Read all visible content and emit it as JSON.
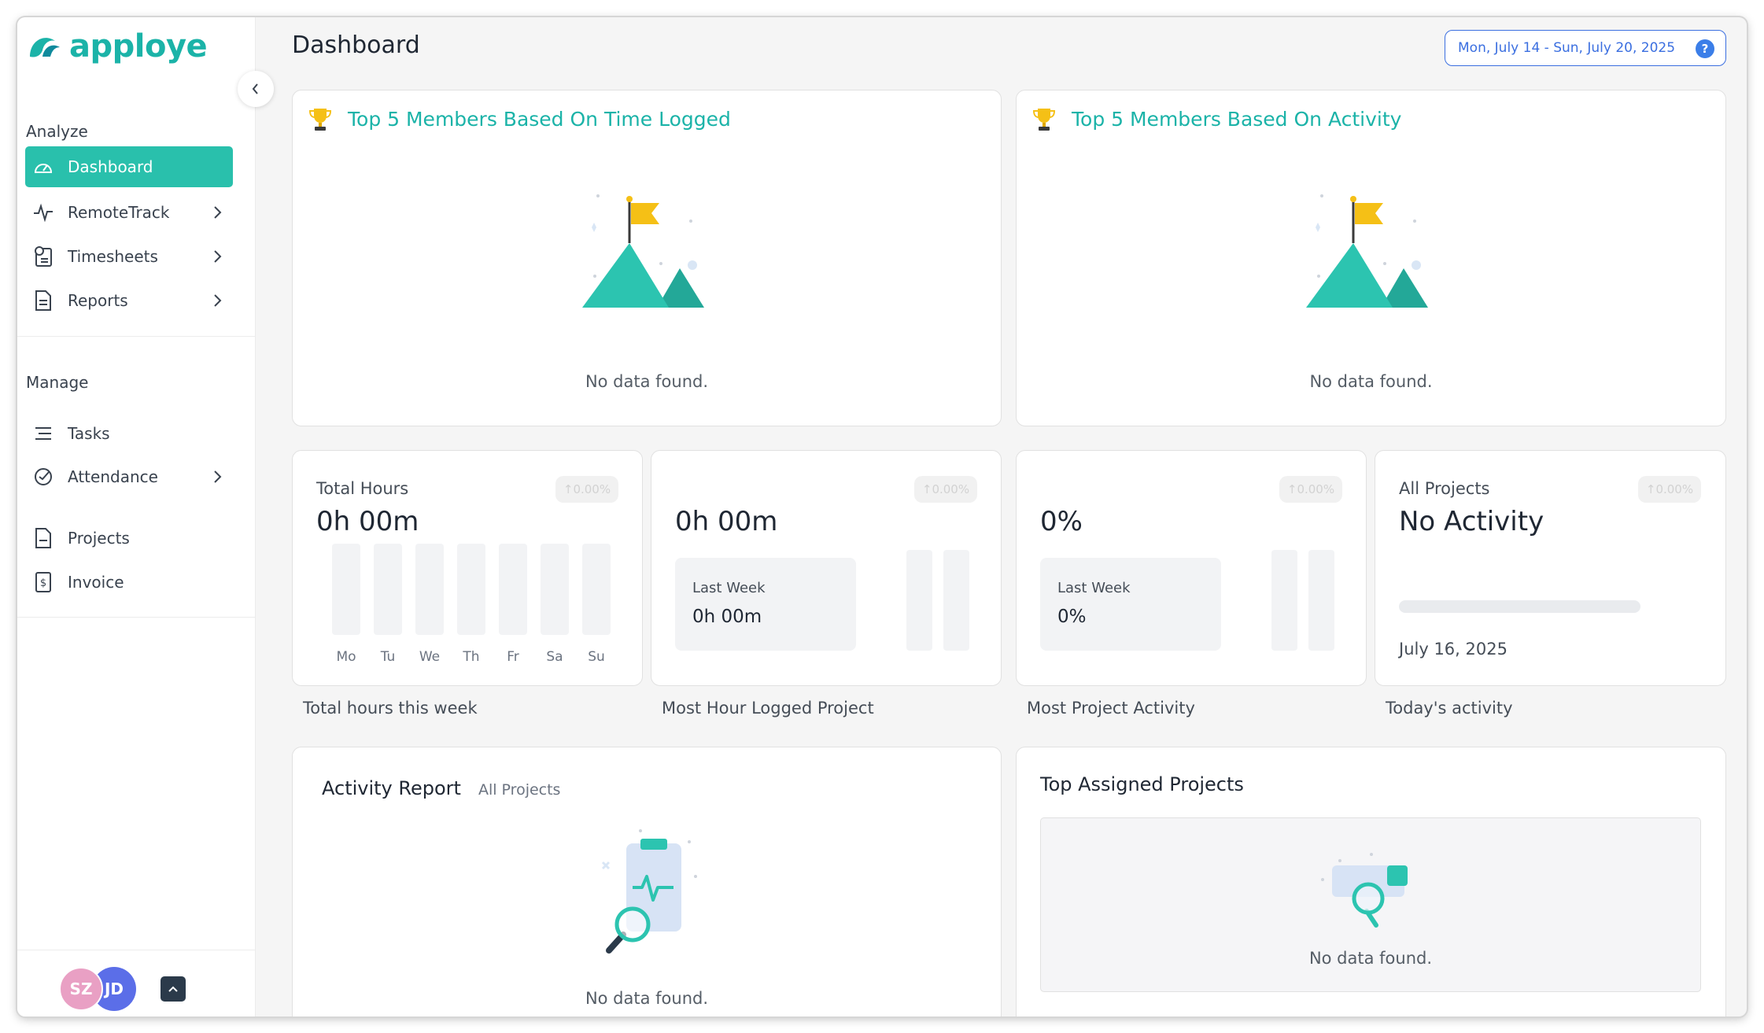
{
  "app": {
    "name": "apploye"
  },
  "sidebar": {
    "sections": {
      "analyze": "Analyze",
      "manage": "Manage"
    },
    "items": [
      {
        "label": "Dashboard"
      },
      {
        "label": "RemoteTrack"
      },
      {
        "label": "Timesheets"
      },
      {
        "label": "Reports"
      },
      {
        "label": "Tasks"
      },
      {
        "label": "Attendance"
      },
      {
        "label": "Projects"
      },
      {
        "label": "Invoice"
      }
    ],
    "avatars": [
      {
        "initials": "SZ",
        "color": "#e9a0c4"
      },
      {
        "initials": "JD",
        "color": "#5b6ee8"
      }
    ]
  },
  "header": {
    "title": "Dashboard",
    "date_range": "Mon, July 14 - Sun, July 20, 2025",
    "help": "?"
  },
  "top_cards": [
    {
      "title": "Top 5 Members Based On Time Logged",
      "empty": "No data found."
    },
    {
      "title": "Top 5 Members Based On Activity",
      "empty": "No data found."
    }
  ],
  "stats": [
    {
      "label": "Total Hours",
      "value": "0h 00m",
      "badge": "↑0.00%",
      "days": [
        "Mo",
        "Tu",
        "We",
        "Th",
        "Fr",
        "Sa",
        "Su"
      ],
      "caption": "Total hours this week"
    },
    {
      "value": "0h 00m",
      "badge": "↑0.00%",
      "last_week_label": "Last Week",
      "last_week_value": "0h 00m",
      "caption": "Most Hour Logged Project"
    },
    {
      "value": "0%",
      "badge": "↑0.00%",
      "last_week_label": "Last Week",
      "last_week_value": "0%",
      "caption": "Most Project Activity"
    },
    {
      "label": "All Projects",
      "value": "No Activity",
      "badge": "↑0.00%",
      "date": "July 16, 2025",
      "progress": 0,
      "caption": "Today's activity"
    }
  ],
  "activity_report": {
    "title": "Activity Report",
    "filter": "All Projects",
    "empty": "No data found."
  },
  "top_assigned": {
    "title": "Top Assigned Projects",
    "empty": "No data found."
  },
  "colors": {
    "accent": "#29c0ac",
    "accent_text": "#1bb3a8",
    "date_border": "#3b6fe0"
  }
}
